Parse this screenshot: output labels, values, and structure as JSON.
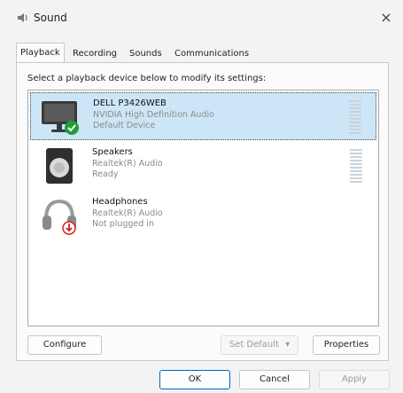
{
  "window": {
    "title": "Sound",
    "close_glyph": "×"
  },
  "tabs": [
    {
      "label": "Playback",
      "active": true
    },
    {
      "label": "Recording",
      "active": false
    },
    {
      "label": "Sounds",
      "active": false
    },
    {
      "label": "Communications",
      "active": false
    }
  ],
  "instruction": "Select a playback device below to modify its settings:",
  "devices": [
    {
      "name": "DELL P3426WEB",
      "driver": "NVIDIA High Definition Audio",
      "status": "Default Device",
      "icon": "monitor-icon",
      "badge": "default-check-icon",
      "selected": true
    },
    {
      "name": "Speakers",
      "driver": "Realtek(R) Audio",
      "status": "Ready",
      "icon": "speaker-icon",
      "selected": false
    },
    {
      "name": "Headphones",
      "driver": "Realtek(R) Audio",
      "status": "Not plugged in",
      "icon": "headphones-icon",
      "badge": "unplugged-arrow-icon",
      "selected": false
    }
  ],
  "buttons": {
    "configure": "Configure",
    "set_default": "Set Default",
    "properties": "Properties",
    "ok": "OK",
    "cancel": "Cancel",
    "apply": "Apply"
  },
  "colors": {
    "selection": "#cde6f7",
    "check_green": "#1e9e3a",
    "unplugged_red": "#d32020",
    "accent": "#0067c0"
  }
}
